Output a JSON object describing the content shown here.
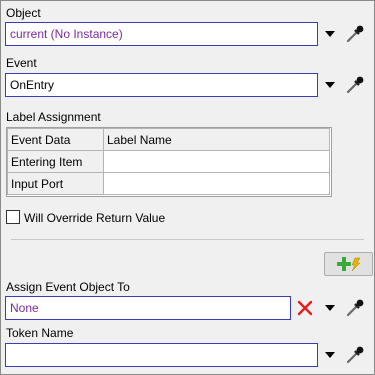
{
  "object": {
    "label": "Object",
    "value": "current (No Instance)"
  },
  "event": {
    "label": "Event",
    "value": "OnEntry"
  },
  "label_assignment": {
    "title": "Label Assignment",
    "columns": [
      "Event Data",
      "Label Name"
    ],
    "rows": [
      {
        "event_data": "Entering Item",
        "label_name": ""
      },
      {
        "event_data": "Input Port",
        "label_name": ""
      }
    ]
  },
  "override": {
    "label": "Will Override Return Value",
    "checked": false
  },
  "assign_event_object": {
    "label": "Assign Event Object To",
    "value": "None"
  },
  "token_name": {
    "label": "Token Name",
    "value": ""
  },
  "icons": {
    "dropdown": "chevron-down-icon",
    "picker": "eyedropper-icon",
    "clear": "red-x-icon",
    "add": "add-lightning-icon"
  },
  "colors": {
    "field_border": "#3c3cb4",
    "purple_text": "#7a2aa0",
    "clear_x": "#e02020",
    "add_plus": "#3aa83a",
    "lightning": "#e8b400"
  }
}
